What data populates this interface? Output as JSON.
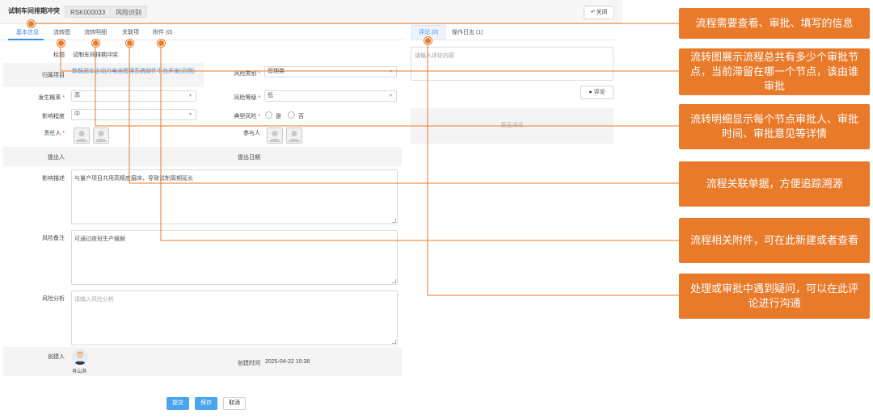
{
  "header": {
    "title": "试制车间排期冲突",
    "code": "RSK000033",
    "type_chip": "风险识别",
    "close_label": "关闭"
  },
  "left_tabs": [
    "基本信息",
    "流转图",
    "流转明细",
    "关联项",
    "附件 (0)"
  ],
  "right_tabs": [
    "评论 (0)",
    "操作日志 (1)"
  ],
  "form": {
    "title_label": "标题",
    "title_value": "试制车间排期冲突",
    "project_label": "归属项目",
    "project_value": "新能源车企动力电池管理系统软件平台开发(示例)",
    "risk_category_label": "风险类别",
    "risk_category_value": "管理类",
    "probability_label": "发生概率",
    "probability_value": "高",
    "risk_level_label": "风险等级",
    "risk_level_value": "低",
    "impact_label": "影响程度",
    "impact_value": "中",
    "typical_label": "典型风险",
    "typical_yes": "是",
    "typical_no": "否",
    "owner_label": "责任人",
    "participant_label": "参与人",
    "proposer_label": "提出人",
    "propose_date_label": "提出日期",
    "impact_desc_label": "影响描述",
    "impact_desc_value": "与量产项目共用高精度磨床，导致试制周期延长",
    "remark_label": "风险备注",
    "remark_value": "可通过夜班生产缓解",
    "analysis_label": "风险分析",
    "analysis_placeholder": "请输入风险分析",
    "creator_label": "创建人",
    "creator_name": "肖山淇",
    "created_time_label": "创建时间",
    "created_time_value": "2025-04-22 10:38"
  },
  "actions": {
    "submit": "提交",
    "save": "保存",
    "cancel": "取消"
  },
  "comments": {
    "placeholder": "请输入评论内容",
    "button": "评论",
    "empty": "暂无评论"
  },
  "callouts": [
    "流程需要查看、审批、填写的信息",
    "流转图展示流程总共有多少个审批节点，当前滞留在哪一个节点，该由谁审批",
    "流转明细显示每个节点审批人、审批时间、审批意见等详情",
    "流程关联单据，方便追踪溯源",
    "流程相关附件，可在此新建或者查看",
    "处理或审批中遇到疑问，可以在此评论进行沟通"
  ],
  "colors": {
    "accent": "#3a8ee6",
    "callout": "#e87a2a",
    "primary_button": "#4aa4ee"
  }
}
